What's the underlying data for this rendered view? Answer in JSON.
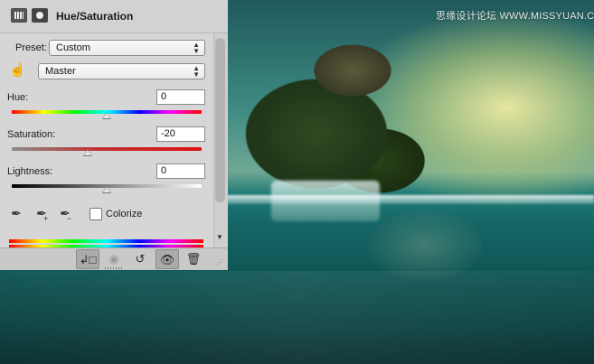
{
  "watermark": "思缘设计论坛 WWW.MISSYUAN.COM",
  "panel": {
    "title": "Hue/Saturation",
    "preset": {
      "label": "Preset:",
      "value": "Custom"
    },
    "channel": {
      "value": "Master"
    },
    "hue": {
      "label": "Hue:",
      "value": "0",
      "level": 0
    },
    "saturation": {
      "label": "Saturation:",
      "value": "-20",
      "level": -20
    },
    "lightness": {
      "label": "Lightness:",
      "value": "0",
      "level": 0
    },
    "colorize": {
      "label": "Colorize",
      "checked": false
    }
  },
  "icons": {
    "adjustment": "adjustment-layer-icon",
    "mask": "mask-icon",
    "hand": "target-hand-icon",
    "eyedropper": "eyedropper-icon",
    "eyedropper_add": "eyedropper-plus-icon",
    "eyedropper_subtract": "eyedropper-minus-icon",
    "clip": "clip-to-layer-icon",
    "view_previous": "view-previous-icon",
    "reset": "reset-icon",
    "visibility": "eye-icon",
    "delete": "trash-icon"
  }
}
